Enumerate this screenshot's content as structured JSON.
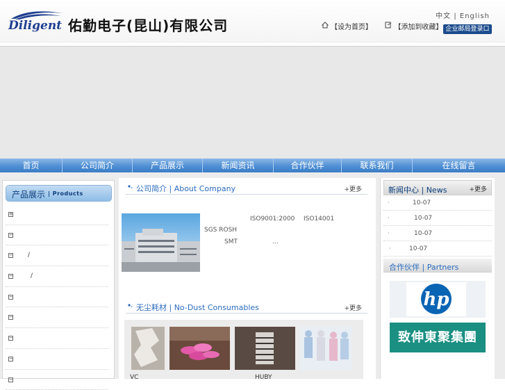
{
  "header": {
    "logo_text": "Diligent",
    "company_name": "佑勤电子(昆山)有限公司",
    "lang_cn": "中文",
    "lang_sep": "|",
    "lang_en": "English",
    "set_home": "【设为首页】",
    "add_favorite": "【添加到收藏】",
    "mail_login": "企业邮局登录口"
  },
  "nav": {
    "items": [
      "首页",
      "公司简介",
      "产品展示",
      "新闻资讯",
      "合作伙伴",
      "联系我们",
      "在线留言"
    ]
  },
  "left": {
    "title_cn": "产品展示",
    "title_en": "| Products",
    "items": [
      {
        "icon": "+",
        "text": ""
      },
      {
        "icon": "−",
        "text": ""
      },
      {
        "icon": "−",
        "text": "/"
      },
      {
        "icon": "−",
        "text": "/"
      },
      {
        "icon": "−",
        "text": ""
      },
      {
        "icon": "−",
        "text": ""
      },
      {
        "icon": "−",
        "text": ""
      },
      {
        "icon": "−",
        "text": ""
      },
      {
        "icon": "−",
        "text": ""
      }
    ]
  },
  "about": {
    "title": "公司简介 | About Company",
    "more": "+更多",
    "iso9001": "ISO9001:2000",
    "iso14001": "ISO14001",
    "sgs": "SGS ROSH",
    "smt": "SMT",
    "ellipsis": "..."
  },
  "consumables": {
    "title": "无尘耗材 | No-Dust Consumables",
    "more": "+更多",
    "captions": [
      "VC",
      "",
      "HUBY",
      ""
    ]
  },
  "news": {
    "title": "新闻中心 | News",
    "more": "+更多",
    "items": [
      {
        "bullet": "·",
        "date": "10-07"
      },
      {
        "bullet": "·",
        "date": "10-07"
      },
      {
        "bullet": "·",
        "date": "10-07"
      },
      {
        "bullet": "·",
        "date": "10-07"
      }
    ]
  },
  "partners": {
    "title": "合作伙伴 | Partners",
    "hp_text": "hp",
    "partner2_text": "致伸東聚集團"
  },
  "colors": {
    "nav_blue": "#4f8fd4",
    "brand_navy": "#1b4b8c",
    "section_title_blue": "#2b6cbf"
  }
}
